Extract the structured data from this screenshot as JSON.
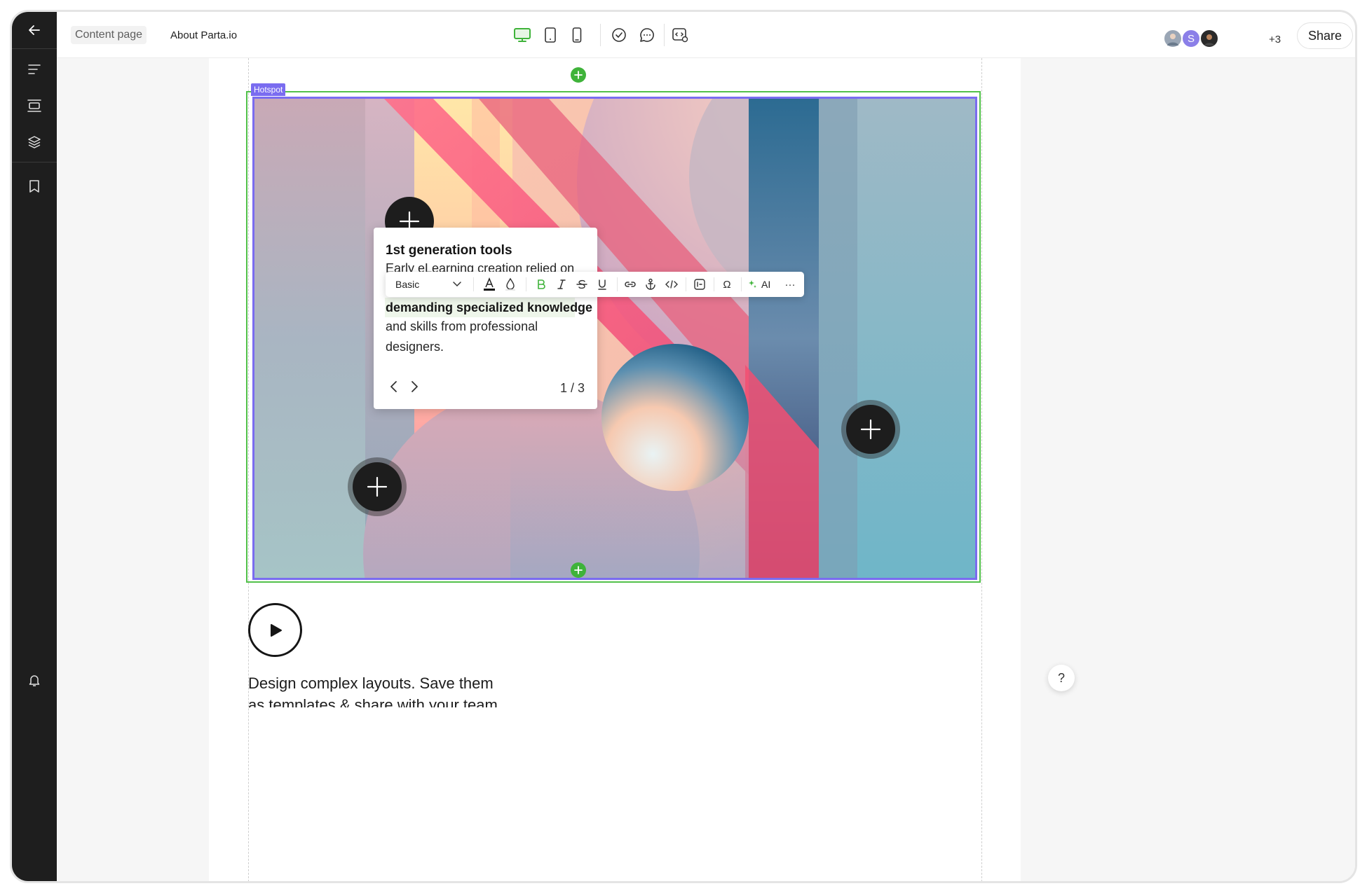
{
  "breadcrumb": {
    "section": "Content page",
    "page": "About Parta.io"
  },
  "collaborators": {
    "avatar_s": "S",
    "more": "+3"
  },
  "share_label": "Share",
  "hotspot": {
    "tag": "Hotspot"
  },
  "popover": {
    "title": "1st generation tools",
    "line1": "Early eLearning creation relied on",
    "line_highlight": "demanding specialized knowledge",
    "line3": "and skills from professional",
    "line4": "designers.",
    "pager": "1 / 3"
  },
  "format_toolbar": {
    "style_select": "Basic",
    "ai_label": "AI",
    "more": "···",
    "special_char": "Ω"
  },
  "content": {
    "line1": "Design complex layouts. Save them",
    "line2": "as templates & share with your team"
  },
  "help": "?",
  "colors": {
    "accent_green": "#3fb33a",
    "hotspot_purple": "#7a6cf0",
    "rail": "#1e1e1e"
  }
}
